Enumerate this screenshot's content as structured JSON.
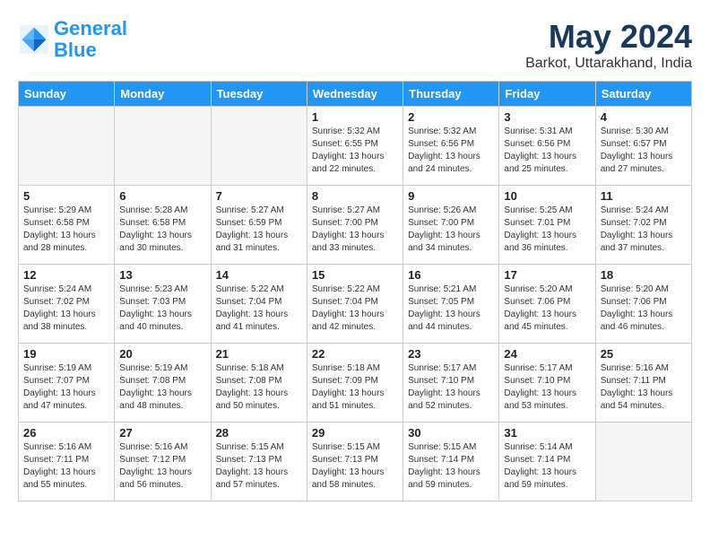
{
  "header": {
    "logo_line1": "General",
    "logo_line2": "Blue",
    "month_title": "May 2024",
    "location": "Barkot, Uttarakhand, India"
  },
  "days_of_week": [
    "Sunday",
    "Monday",
    "Tuesday",
    "Wednesday",
    "Thursday",
    "Friday",
    "Saturday"
  ],
  "weeks": [
    [
      {
        "num": "",
        "empty": true
      },
      {
        "num": "",
        "empty": true
      },
      {
        "num": "",
        "empty": true
      },
      {
        "num": "1",
        "sunrise": "5:32 AM",
        "sunset": "6:55 PM",
        "daylight": "13 hours and 22 minutes."
      },
      {
        "num": "2",
        "sunrise": "5:32 AM",
        "sunset": "6:56 PM",
        "daylight": "13 hours and 24 minutes."
      },
      {
        "num": "3",
        "sunrise": "5:31 AM",
        "sunset": "6:56 PM",
        "daylight": "13 hours and 25 minutes."
      },
      {
        "num": "4",
        "sunrise": "5:30 AM",
        "sunset": "6:57 PM",
        "daylight": "13 hours and 27 minutes."
      }
    ],
    [
      {
        "num": "5",
        "sunrise": "5:29 AM",
        "sunset": "6:58 PM",
        "daylight": "13 hours and 28 minutes."
      },
      {
        "num": "6",
        "sunrise": "5:28 AM",
        "sunset": "6:58 PM",
        "daylight": "13 hours and 30 minutes."
      },
      {
        "num": "7",
        "sunrise": "5:27 AM",
        "sunset": "6:59 PM",
        "daylight": "13 hours and 31 minutes."
      },
      {
        "num": "8",
        "sunrise": "5:27 AM",
        "sunset": "7:00 PM",
        "daylight": "13 hours and 33 minutes."
      },
      {
        "num": "9",
        "sunrise": "5:26 AM",
        "sunset": "7:00 PM",
        "daylight": "13 hours and 34 minutes."
      },
      {
        "num": "10",
        "sunrise": "5:25 AM",
        "sunset": "7:01 PM",
        "daylight": "13 hours and 36 minutes."
      },
      {
        "num": "11",
        "sunrise": "5:24 AM",
        "sunset": "7:02 PM",
        "daylight": "13 hours and 37 minutes."
      }
    ],
    [
      {
        "num": "12",
        "sunrise": "5:24 AM",
        "sunset": "7:02 PM",
        "daylight": "13 hours and 38 minutes."
      },
      {
        "num": "13",
        "sunrise": "5:23 AM",
        "sunset": "7:03 PM",
        "daylight": "13 hours and 40 minutes."
      },
      {
        "num": "14",
        "sunrise": "5:22 AM",
        "sunset": "7:04 PM",
        "daylight": "13 hours and 41 minutes."
      },
      {
        "num": "15",
        "sunrise": "5:22 AM",
        "sunset": "7:04 PM",
        "daylight": "13 hours and 42 minutes."
      },
      {
        "num": "16",
        "sunrise": "5:21 AM",
        "sunset": "7:05 PM",
        "daylight": "13 hours and 44 minutes."
      },
      {
        "num": "17",
        "sunrise": "5:20 AM",
        "sunset": "7:06 PM",
        "daylight": "13 hours and 45 minutes."
      },
      {
        "num": "18",
        "sunrise": "5:20 AM",
        "sunset": "7:06 PM",
        "daylight": "13 hours and 46 minutes."
      }
    ],
    [
      {
        "num": "19",
        "sunrise": "5:19 AM",
        "sunset": "7:07 PM",
        "daylight": "13 hours and 47 minutes."
      },
      {
        "num": "20",
        "sunrise": "5:19 AM",
        "sunset": "7:08 PM",
        "daylight": "13 hours and 48 minutes."
      },
      {
        "num": "21",
        "sunrise": "5:18 AM",
        "sunset": "7:08 PM",
        "daylight": "13 hours and 50 minutes."
      },
      {
        "num": "22",
        "sunrise": "5:18 AM",
        "sunset": "7:09 PM",
        "daylight": "13 hours and 51 minutes."
      },
      {
        "num": "23",
        "sunrise": "5:17 AM",
        "sunset": "7:10 PM",
        "daylight": "13 hours and 52 minutes."
      },
      {
        "num": "24",
        "sunrise": "5:17 AM",
        "sunset": "7:10 PM",
        "daylight": "13 hours and 53 minutes."
      },
      {
        "num": "25",
        "sunrise": "5:16 AM",
        "sunset": "7:11 PM",
        "daylight": "13 hours and 54 minutes."
      }
    ],
    [
      {
        "num": "26",
        "sunrise": "5:16 AM",
        "sunset": "7:11 PM",
        "daylight": "13 hours and 55 minutes."
      },
      {
        "num": "27",
        "sunrise": "5:16 AM",
        "sunset": "7:12 PM",
        "daylight": "13 hours and 56 minutes."
      },
      {
        "num": "28",
        "sunrise": "5:15 AM",
        "sunset": "7:13 PM",
        "daylight": "13 hours and 57 minutes."
      },
      {
        "num": "29",
        "sunrise": "5:15 AM",
        "sunset": "7:13 PM",
        "daylight": "13 hours and 58 minutes."
      },
      {
        "num": "30",
        "sunrise": "5:15 AM",
        "sunset": "7:14 PM",
        "daylight": "13 hours and 59 minutes."
      },
      {
        "num": "31",
        "sunrise": "5:14 AM",
        "sunset": "7:14 PM",
        "daylight": "13 hours and 59 minutes."
      },
      {
        "num": "",
        "empty": true
      }
    ]
  ],
  "labels": {
    "sunrise": "Sunrise:",
    "sunset": "Sunset:",
    "daylight": "Daylight:"
  }
}
